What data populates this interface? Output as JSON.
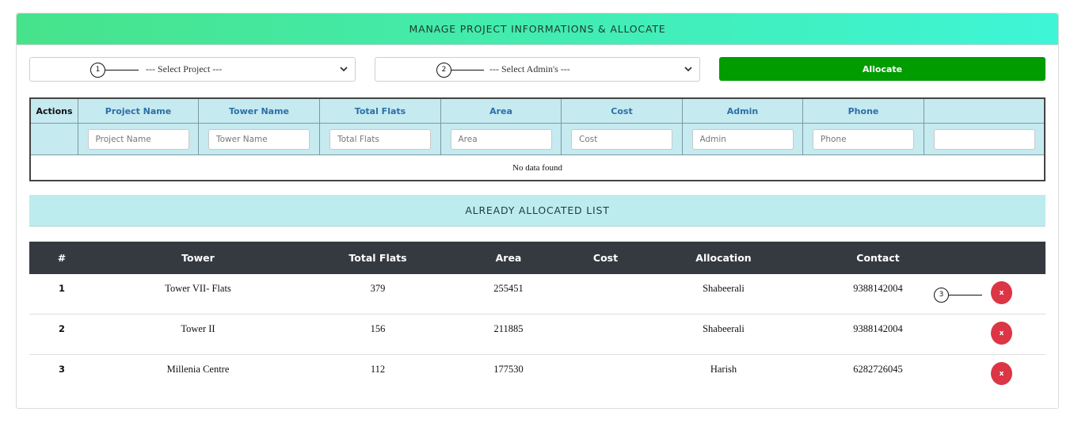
{
  "header": {
    "title": "MANAGE PROJECT INFORMATIONS & ALLOCATE"
  },
  "controls": {
    "project_select": "--- Select Project ---",
    "admin_select": "--- Select Admin's ---",
    "allocate_label": "Allocate"
  },
  "markers": {
    "m1": "1",
    "m2": "2",
    "m3": "3"
  },
  "grid": {
    "columns": [
      "Actions",
      "Project Name",
      "Tower Name",
      "Total Flats",
      "Area",
      "Cost",
      "Admin",
      "Phone",
      ""
    ],
    "filter_placeholders": [
      "Project Name",
      "Tower Name",
      "Total Flats",
      "Area",
      "Cost",
      "Admin",
      "Phone",
      ""
    ],
    "empty_text": "No data found"
  },
  "allocated": {
    "title": "ALREADY ALLOCATED LIST",
    "columns": [
      "#",
      "Tower",
      "Total Flats",
      "Area",
      "Cost",
      "Allocation",
      "Contact",
      ""
    ],
    "delete_label": "x",
    "rows": [
      {
        "num": "1",
        "tower": "Tower VII- Flats",
        "flats": "379",
        "area": "255451",
        "cost": "",
        "allocation": "Shabeerali",
        "contact": "9388142004"
      },
      {
        "num": "2",
        "tower": "Tower II",
        "flats": "156",
        "area": "211885",
        "cost": "",
        "allocation": "Shabeerali",
        "contact": "9388142004"
      },
      {
        "num": "3",
        "tower": "Millenia Centre",
        "flats": "112",
        "area": "177530",
        "cost": "",
        "allocation": "Harish",
        "contact": "6282726045"
      }
    ]
  },
  "colors": {
    "allocate": "#009c00",
    "delete": "#dc3545",
    "table_head": "#343a40",
    "section": "#bdecee",
    "grid": "#c5eaf0"
  }
}
